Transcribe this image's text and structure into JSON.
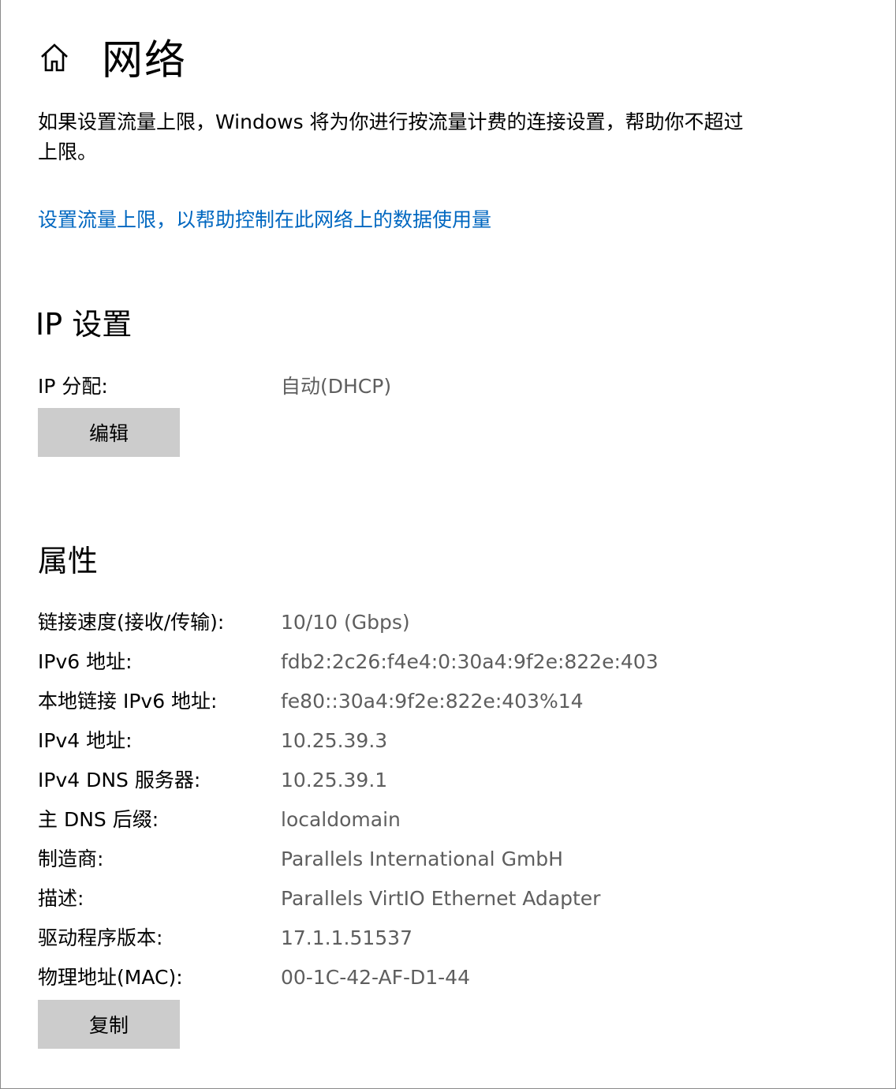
{
  "header": {
    "title": "网络",
    "home_icon": "home-icon"
  },
  "description": "如果设置流量上限，Windows 将为你进行按流量计费的连接设置，帮助你不超过上限。",
  "data_limit_link": "设置流量上限，以帮助控制在此网络上的数据使用量",
  "ip_settings": {
    "title": "IP 设置",
    "assignment_label": "IP 分配:",
    "assignment_value": "自动(DHCP)",
    "edit_button": "编辑"
  },
  "properties": {
    "title": "属性",
    "rows": [
      {
        "label": "链接速度(接收/传输):",
        "value": "10/10 (Gbps)"
      },
      {
        "label": "IPv6 地址:",
        "value": "fdb2:2c26:f4e4:0:30a4:9f2e:822e:403"
      },
      {
        "label": "本地链接 IPv6 地址:",
        "value": "fe80::30a4:9f2e:822e:403%14"
      },
      {
        "label": "IPv4 地址:",
        "value": "10.25.39.3"
      },
      {
        "label": "IPv4 DNS 服务器:",
        "value": "10.25.39.1"
      },
      {
        "label": "主 DNS 后缀:",
        "value": "localdomain"
      },
      {
        "label": "制造商:",
        "value": "Parallels International GmbH"
      },
      {
        "label": "描述:",
        "value": "Parallels VirtIO Ethernet Adapter"
      },
      {
        "label": "驱动程序版本:",
        "value": "17.1.1.51537"
      },
      {
        "label": "物理地址(MAC):",
        "value": "00-1C-42-AF-D1-44"
      }
    ],
    "copy_button": "复制"
  },
  "colors": {
    "link": "#0067c0",
    "value_text": "#5e5e5e",
    "button_bg": "#cccccc"
  }
}
